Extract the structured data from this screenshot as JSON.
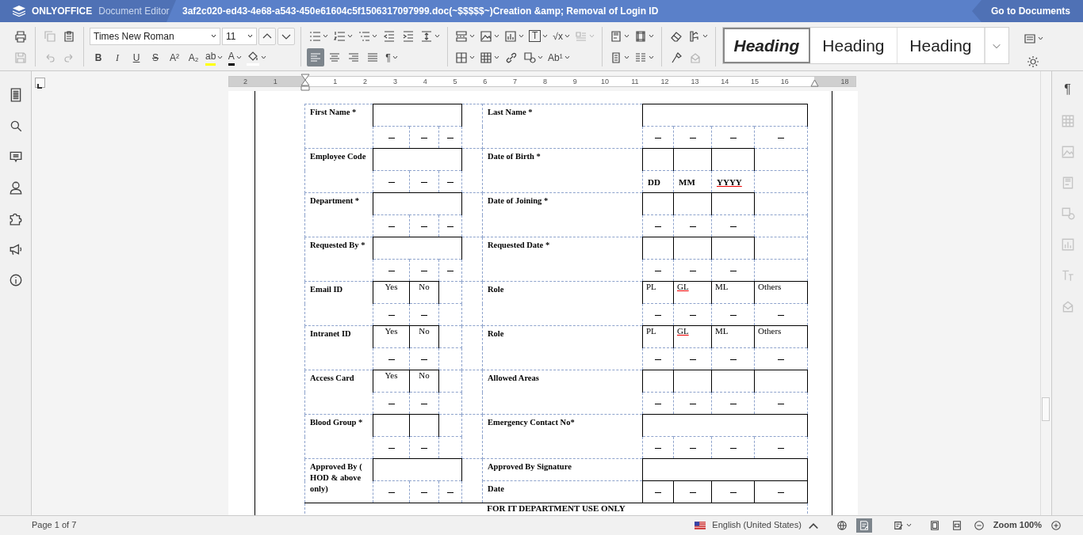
{
  "header": {
    "brand": "ONLYOFFICE",
    "app": "Document Editor",
    "title": "3af2c020-ed43-4e68-a543-450e61604c5f1506317097999.doc(~$$$$$~)Creation &amp; Removal of Login ID",
    "go_to": "Go to Documents"
  },
  "toolbar": {
    "font_name": "Times New Roman",
    "font_size": "11",
    "groups": [
      {
        "rows": [
          [
            {
              "kind": "print",
              "disabled": false
            }
          ],
          [
            {
              "kind": "save",
              "disabled": true
            }
          ]
        ]
      },
      {
        "rows": [
          [
            {
              "kind": "copy",
              "disabled": true
            },
            {
              "kind": "paste",
              "disabled": false
            }
          ],
          [
            {
              "kind": "undo",
              "disabled": true
            },
            {
              "kind": "redo",
              "disabled": true
            }
          ]
        ]
      },
      {
        "rows": [
          [
            {
              "kind": "fontname",
              "disabled": false
            },
            {
              "kind": "fontsize",
              "disabled": false
            },
            {
              "kind": "grow",
              "disabled": false
            },
            {
              "kind": "shrink",
              "disabled": false
            }
          ],
          [
            {
              "kind": "bold",
              "label": "B",
              "disabled": false
            },
            {
              "kind": "italic",
              "label": "I",
              "disabled": false
            },
            {
              "kind": "underline",
              "label": "U",
              "disabled": false
            },
            {
              "kind": "strike",
              "label": "S",
              "disabled": false
            },
            {
              "kind": "superscript",
              "label": "A²",
              "disabled": false
            },
            {
              "kind": "subscript",
              "label": "A₂",
              "disabled": false
            },
            {
              "kind": "highlight",
              "label": "ab",
              "dropdown": true,
              "disabled": false
            },
            {
              "kind": "fontcolor",
              "label": "A",
              "dropdown": true,
              "disabled": false
            },
            {
              "kind": "fill",
              "dropdown": true,
              "disabled": false
            }
          ]
        ]
      },
      {
        "rows": [
          [
            {
              "kind": "bullets",
              "dropdown": true,
              "disabled": false
            },
            {
              "kind": "numbering",
              "dropdown": true,
              "disabled": false
            },
            {
              "kind": "multilevel",
              "dropdown": true,
              "disabled": false
            },
            {
              "kind": "outdent",
              "disabled": false
            },
            {
              "kind": "indent",
              "disabled": false
            },
            {
              "kind": "spacing",
              "dropdown": true,
              "disabled": false
            }
          ],
          [
            {
              "kind": "alignleft",
              "selected": true,
              "disabled": false
            },
            {
              "kind": "aligncenter",
              "selected": false,
              "disabled": false
            },
            {
              "kind": "alignright",
              "selected": false,
              "disabled": false
            },
            {
              "kind": "justify",
              "selected": false,
              "disabled": false
            },
            {
              "kind": "text",
              "label": "¶",
              "dropdown": true,
              "disabled": false
            }
          ]
        ]
      },
      {
        "rows": [
          [
            {
              "kind": "pagebreak",
              "dropdown": true,
              "disabled": false
            },
            {
              "kind": "image",
              "dropdown": true,
              "disabled": false
            },
            {
              "kind": "chart",
              "dropdown": true,
              "disabled": false
            },
            {
              "kind": "textbox",
              "label": "T",
              "dropdown": true,
              "disabled": false
            },
            {
              "kind": "text",
              "label": "√x",
              "dropdown": true,
              "disabled": false
            },
            {
              "kind": "dropcap",
              "dropdown": true,
              "disabled": true
            }
          ],
          [
            {
              "kind": "borders",
              "dropdown": true,
              "disabled": false
            },
            {
              "kind": "table",
              "dropdown": true,
              "disabled": false
            },
            {
              "kind": "link",
              "disabled": false
            },
            {
              "kind": "shape",
              "dropdown": true,
              "disabled": false
            },
            {
              "kind": "text",
              "label": "Ab¹",
              "dropdown": true,
              "disabled": false
            }
          ]
        ]
      },
      {
        "rows": [
          [
            {
              "kind": "header",
              "dropdown": true,
              "disabled": false
            },
            {
              "kind": "margins",
              "dropdown": true,
              "disabled": false
            }
          ],
          [
            {
              "kind": "pagesize",
              "dropdown": true,
              "disabled": false
            },
            {
              "kind": "columns",
              "dropdown": true,
              "disabled": false
            }
          ]
        ]
      },
      {
        "rows": [
          [
            {
              "kind": "eraser",
              "disabled": false
            },
            {
              "kind": "palette",
              "dropdown": true,
              "disabled": false
            }
          ],
          [
            {
              "kind": "painter",
              "disabled": false
            },
            {
              "kind": "mail",
              "disabled": true
            }
          ]
        ]
      }
    ],
    "styles": [
      {
        "label": "Heading",
        "selected": true
      },
      {
        "label": "Heading",
        "selected": false
      },
      {
        "label": "Heading",
        "selected": false
      }
    ]
  },
  "left_panel": [
    {
      "kind": "file"
    },
    {
      "kind": "search"
    },
    {
      "kind": "comment"
    },
    {
      "kind": "person"
    },
    {
      "kind": "puzzle"
    },
    {
      "kind": "megaphone"
    },
    {
      "kind": "info"
    }
  ],
  "right_panel": [
    {
      "kind": "text",
      "label": "¶",
      "disabled": false
    },
    {
      "kind": "table",
      "disabled": true
    },
    {
      "kind": "image",
      "disabled": true
    },
    {
      "kind": "header",
      "disabled": true
    },
    {
      "kind": "shape",
      "disabled": true
    },
    {
      "kind": "chart",
      "disabled": true
    },
    {
      "kind": "textart",
      "disabled": true
    },
    {
      "kind": "mail",
      "disabled": true
    }
  ],
  "ruler": {
    "labels": [
      "2",
      "1",
      "1",
      "2",
      "3",
      "4",
      "5",
      "6",
      "7",
      "8",
      "9",
      "10",
      "11",
      "12",
      "13",
      "14",
      "15",
      "16",
      "18"
    ]
  },
  "form": {
    "rows": [
      {
        "label": "First Name *",
        "left": {
          "kind": "wide"
        },
        "label2": "Last Name *",
        "right": {
          "kind": "full"
        }
      },
      {
        "label": "Employee Code",
        "left": {
          "kind": "wide"
        },
        "label2": "Date of Birth *",
        "right": {
          "kind": "date",
          "cells": [
            {
              "text": "DD",
              "misspelled": false
            },
            {
              "text": "MM",
              "misspelled": false
            },
            {
              "text": "YYYY",
              "misspelled": true
            }
          ]
        }
      },
      {
        "label": "Department *",
        "left": {
          "kind": "wide"
        },
        "label2": "Date of Joining *",
        "right": {
          "kind": "date"
        }
      },
      {
        "label": "Requested By *",
        "left": {
          "kind": "wide"
        },
        "label2": "Requested Date *",
        "right": {
          "kind": "date"
        }
      },
      {
        "label": "Email ID",
        "left": {
          "kind": "pair",
          "options": [
            "Yes",
            "No"
          ]
        },
        "label2": "Role",
        "right": {
          "kind": "options",
          "cells": [
            {
              "text": "PL",
              "misspelled": false
            },
            {
              "text": "GL",
              "misspelled": true
            },
            {
              "text": "ML",
              "misspelled": false
            },
            {
              "text": "Others",
              "misspelled": false
            }
          ]
        }
      },
      {
        "label": "Intranet ID",
        "left": {
          "kind": "pair",
          "options": [
            "Yes",
            "No"
          ]
        },
        "label2": "Role",
        "right": {
          "kind": "options",
          "cells": [
            {
              "text": "PL",
              "misspelled": false
            },
            {
              "text": "GL",
              "misspelled": true
            },
            {
              "text": "ML",
              "misspelled": false
            },
            {
              "text": "Others",
              "misspelled": false
            }
          ]
        }
      },
      {
        "label": "Access Card",
        "left": {
          "kind": "pair",
          "options": [
            "Yes",
            "No"
          ]
        },
        "label2": "Allowed Areas",
        "right": {
          "kind": "grid"
        }
      },
      {
        "label": "Blood Group *",
        "left": {
          "kind": "pair"
        },
        "label2": "Emergency Contact No*",
        "right": {
          "kind": "full"
        }
      },
      {
        "label": "Approved By ( HOD & above only)",
        "left": {
          "kind": "wide"
        },
        "label2": "Approved By Signature",
        "label3": "Date",
        "right": {
          "kind": "signature"
        }
      }
    ],
    "footer_heading": "FOR IT DEPARTMENT USE ONLY"
  },
  "status_bar": {
    "page": "Page 1 of 7",
    "language": "English (United States)",
    "track_changes": true,
    "zoom": "Zoom 100%"
  }
}
